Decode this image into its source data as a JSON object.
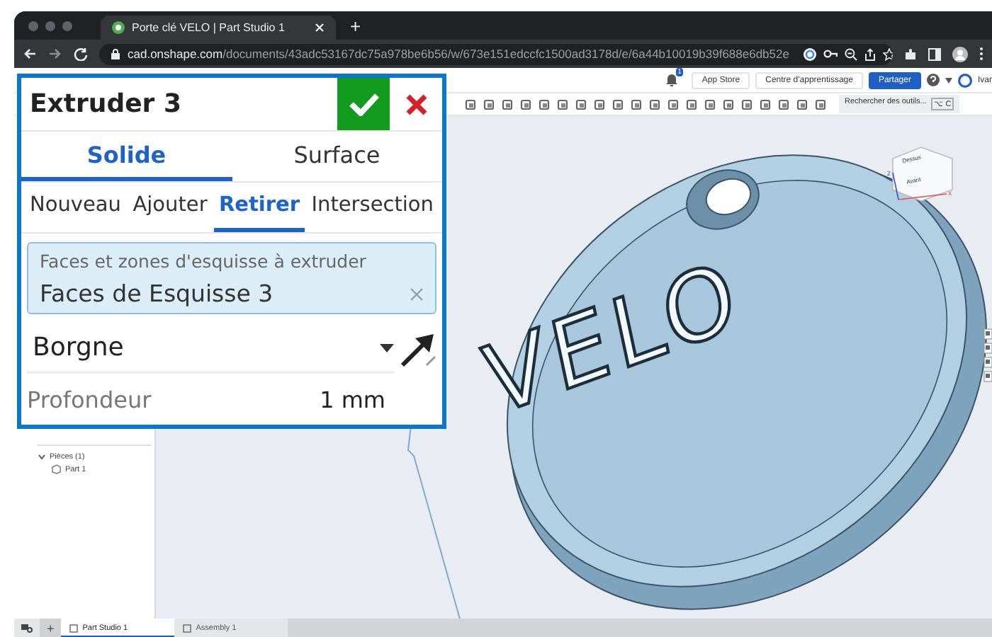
{
  "browser": {
    "tab_title": "Porte clé VELO | Part Studio 1",
    "new_tab": "+",
    "url_domain": "cad.onshape.com",
    "url_path": "/documents/43adc53167dc75a978be6b56/w/673e151edccfc1500ad3178d/e/6a44b10019b39f688e6db52e"
  },
  "header": {
    "notification_count": "1",
    "buttons": [
      {
        "label": "App Store",
        "kind": "plain"
      },
      {
        "label": "Centre d'apprentissage",
        "kind": "plain"
      },
      {
        "label": "Partager",
        "kind": "primary"
      }
    ],
    "user": "Ivar"
  },
  "toolbar": {
    "search_placeholder": "Rechercher des outils...",
    "shortcut": "⌥ C"
  },
  "feature_dialog": {
    "title": "Extruder 3",
    "body_tabs": [
      {
        "label": "Solide",
        "selected": true
      },
      {
        "label": "Surface",
        "selected": false
      }
    ],
    "operation_tabs": [
      {
        "label": "Nouveau",
        "selected": false
      },
      {
        "label": "Ajouter",
        "selected": false
      },
      {
        "label": "Retirer",
        "selected": true
      },
      {
        "label": "Intersection",
        "selected": false
      }
    ],
    "selection_field": {
      "label": "Faces et zones d'esquisse à extruder",
      "value": "Faces de Esquisse 3"
    },
    "end_type": "Borgne",
    "depth": {
      "label": "Profondeur",
      "value": "1 mm"
    }
  },
  "feature_tree": {
    "items": [
      {
        "label": "Pièces (1)",
        "expanded": true,
        "children": [
          {
            "label": "Part 1"
          }
        ]
      }
    ]
  },
  "viewport": {
    "model_text": "VELO",
    "view_cube": {
      "top": "Dessus",
      "front": "Avant",
      "axis_z": "Z",
      "axis_x": "X"
    }
  },
  "bottom_tabs": {
    "add": "+",
    "tabs": [
      {
        "label": "Part Studio 1",
        "selected": true
      },
      {
        "label": "Assembly 1",
        "selected": false
      }
    ]
  }
}
